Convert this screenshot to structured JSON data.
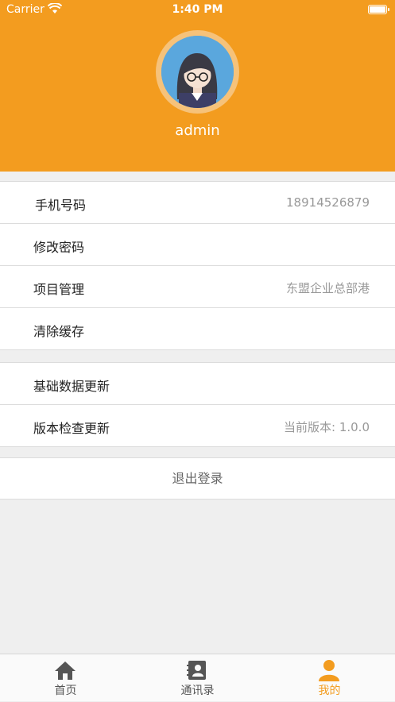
{
  "status_bar": {
    "carrier": "Carrier",
    "time": "1:40 PM"
  },
  "profile": {
    "username": "admin"
  },
  "settings_group1": [
    {
      "label": "手机号码",
      "value": "18914526879"
    },
    {
      "label": "修改密码",
      "value": ""
    },
    {
      "label": "项目管理",
      "value": "东盟企业总部港"
    },
    {
      "label": "清除缓存",
      "value": ""
    }
  ],
  "settings_group2": [
    {
      "label": "基础数据更新",
      "value": ""
    },
    {
      "label": "版本检查更新",
      "value": "当前版本: 1.0.0"
    }
  ],
  "logout_label": "退出登录",
  "tabs": [
    {
      "label": "首页",
      "icon": "home-icon"
    },
    {
      "label": "通讯录",
      "icon": "contacts-icon"
    },
    {
      "label": "我的",
      "icon": "user-icon"
    }
  ],
  "colors": {
    "accent": "#f39c1f",
    "tab_inactive": "#555555"
  }
}
